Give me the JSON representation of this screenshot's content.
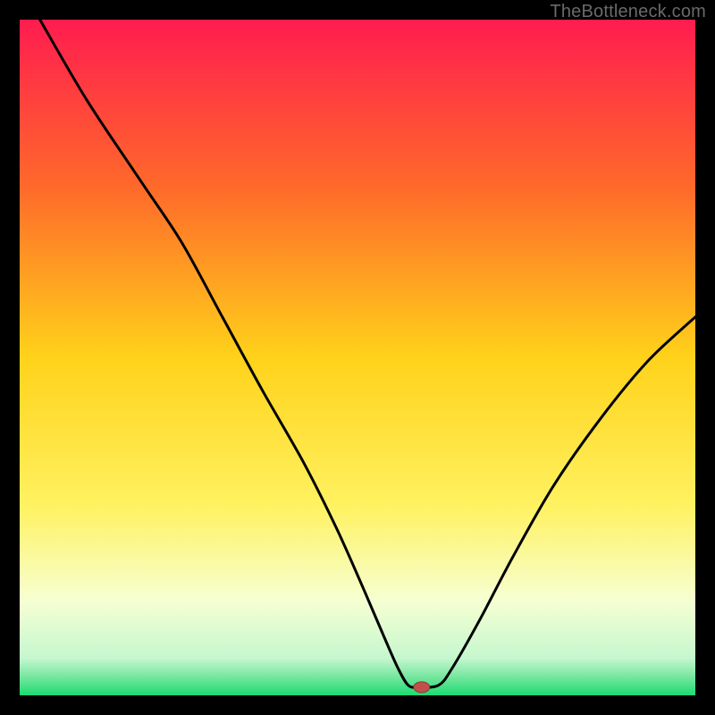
{
  "watermark": "TheBottleneck.com",
  "colors": {
    "frame": "#000000",
    "curve_stroke": "#000000",
    "marker_fill": "#c1504b",
    "marker_stroke": "#8a3a35",
    "watermark": "#6a6a6a",
    "gradient_stops": [
      {
        "offset": 0.0,
        "color": "#ff1c4f"
      },
      {
        "offset": 0.25,
        "color": "#ff6a2a"
      },
      {
        "offset": 0.5,
        "color": "#ffd21a"
      },
      {
        "offset": 0.72,
        "color": "#fff261"
      },
      {
        "offset": 0.86,
        "color": "#f6ffd2"
      },
      {
        "offset": 0.945,
        "color": "#c6f7cf"
      },
      {
        "offset": 0.975,
        "color": "#6fe59a"
      },
      {
        "offset": 1.0,
        "color": "#1bdc73"
      }
    ]
  },
  "chart_data": {
    "type": "line",
    "title": "",
    "xlabel": "",
    "ylabel": "",
    "xlim": [
      0,
      100
    ],
    "ylim": [
      0,
      100
    ],
    "series": [
      {
        "name": "bottleneck-curve",
        "x": [
          3,
          10,
          18,
          24,
          30,
          36,
          42,
          47,
          51,
          54,
          56,
          57.5,
          59,
          62,
          64,
          68,
          73,
          79,
          86,
          93,
          100
        ],
        "values": [
          100,
          88,
          76,
          67,
          56,
          45,
          34.5,
          24.5,
          15.5,
          8.5,
          4,
          1.5,
          1.2,
          1.5,
          4,
          11,
          20.5,
          31,
          41,
          49.5,
          56
        ]
      }
    ],
    "marker": {
      "x": 59.5,
      "y": 1.2
    }
  }
}
